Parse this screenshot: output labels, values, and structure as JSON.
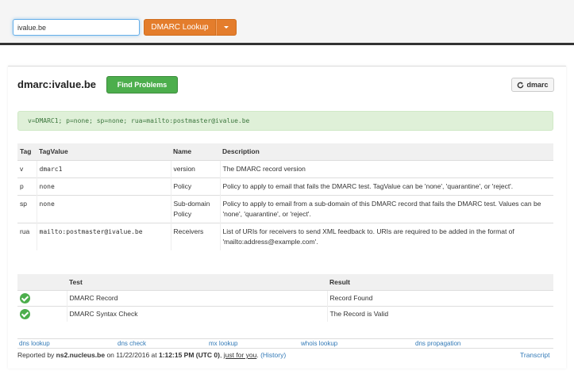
{
  "search": {
    "value": "ivalue.be"
  },
  "lookup_button": {
    "label": "DMARC Lookup"
  },
  "header": {
    "title": "dmarc:ivalue.be",
    "find_problems": "Find Problems",
    "refresh_label": "dmarc"
  },
  "record": "v=DMARC1; p=none; sp=none; rua=mailto:postmaster@ivalue.be",
  "tag_table": {
    "headers": [
      "Tag",
      "TagValue",
      "Name",
      "Description"
    ],
    "rows": [
      {
        "tag": "v",
        "value": "dmarc1",
        "name": "version",
        "description": "The DMARC record version"
      },
      {
        "tag": "p",
        "value": "none",
        "name": "Policy",
        "description": "Policy to apply to email that fails the DMARC test. TagValue can be 'none', 'quarantine', or 'reject'."
      },
      {
        "tag": "sp",
        "value": "none",
        "name": "Sub-domain Policy",
        "description": "Policy to apply to email from a sub-domain of this DMARC record that fails the DMARC test. Values can be 'none', 'quarantine', or 'reject'."
      },
      {
        "tag": "rua",
        "value": "mailto:postmaster@ivalue.be",
        "name": "Receivers",
        "description": "List of URIs for receivers to send XML feedback to. URIs are required to be added in the format of 'mailto:address@example.com'."
      }
    ]
  },
  "test_table": {
    "headers": [
      "",
      "Test",
      "Result"
    ],
    "rows": [
      {
        "status_icon": "check-circle-icon",
        "test": "DMARC Record",
        "result": "Record Found"
      },
      {
        "status_icon": "check-circle-icon",
        "test": "DMARC Syntax Check",
        "result": "The Record is Valid"
      }
    ]
  },
  "footer_links": [
    "dns lookup",
    "dns check",
    "mx lookup",
    "whois lookup",
    "dns propagation"
  ],
  "report": {
    "prefix": "Reported by ",
    "server": "ns2.nucleus.be",
    "on": " on 11/22/2016 at ",
    "time": "1:12:15 PM (UTC 0)",
    "comma": ", ",
    "just_for_you": "just for you",
    "period": ".",
    "history": "(History)"
  },
  "transcript": "Transcript",
  "colors": {
    "accent": "#e47d2c",
    "success": "#4cae4c",
    "link": "#337ab7"
  }
}
